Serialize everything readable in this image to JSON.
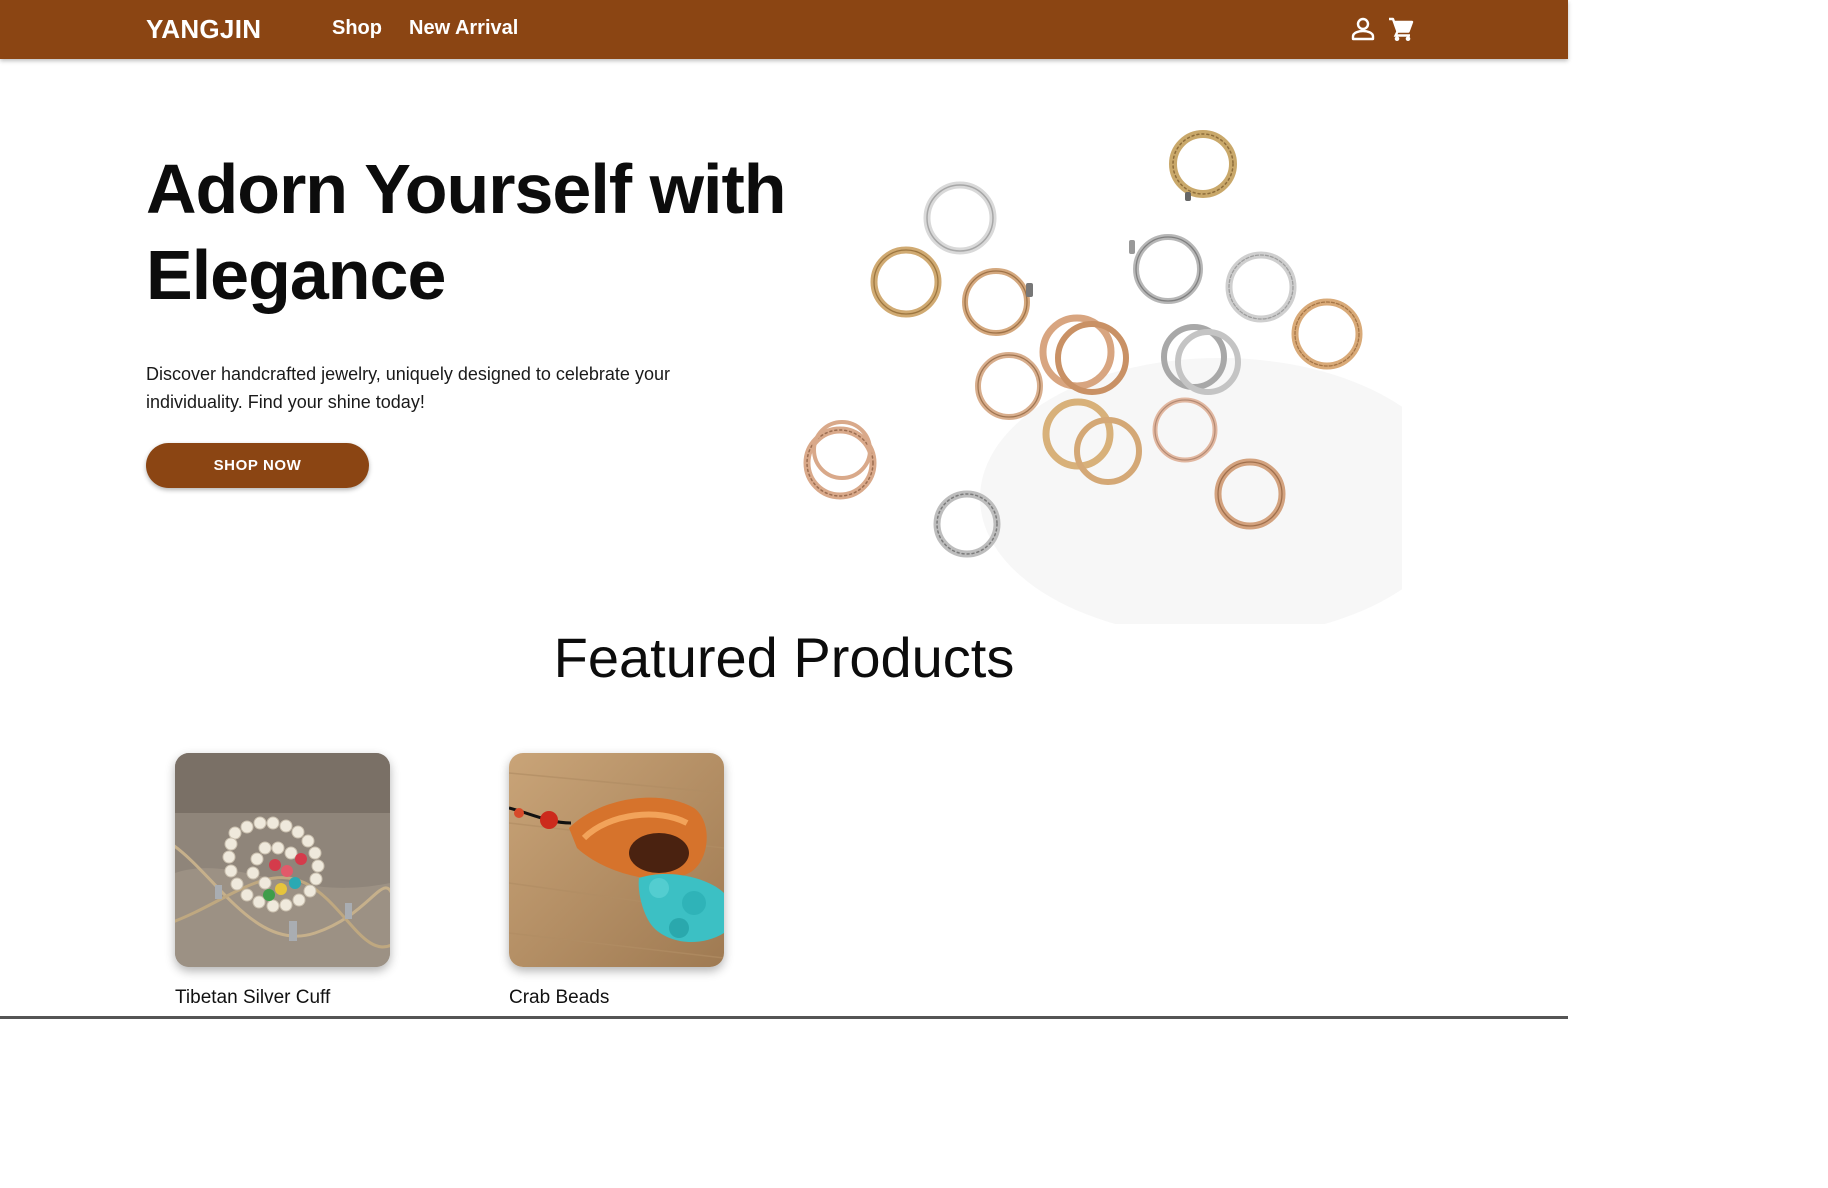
{
  "header": {
    "brand": "YANGJIN",
    "nav": [
      "Shop",
      "New Arrival"
    ],
    "icons": [
      "user-icon",
      "cart-icon"
    ],
    "background": "#8B4513"
  },
  "hero": {
    "title": "Adorn Yourself with Elegance",
    "description": "Discover handcrafted jewelry, uniquely designed to celebrate your individuality. Find your shine today!",
    "cta": "SHOP NOW"
  },
  "featured": {
    "title": "Featured Products",
    "products": [
      {
        "name": "Tibetan Silver Cuff"
      },
      {
        "name": "Crab Beads"
      }
    ]
  },
  "colors": {
    "brand": "#8B4513",
    "text": "#0c0c0c"
  }
}
